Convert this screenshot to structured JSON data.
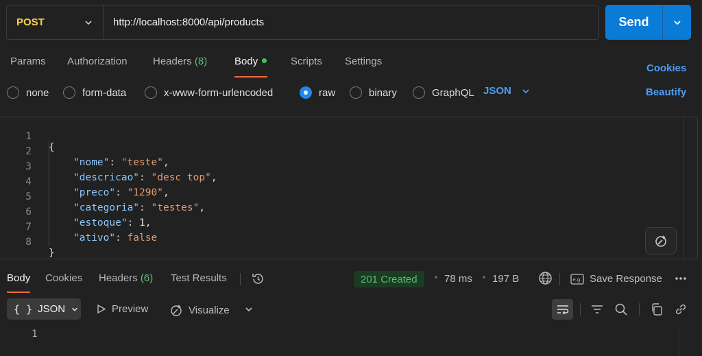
{
  "request": {
    "method": "POST",
    "url": "http://localhost:8000/api/products",
    "send_label": "Send"
  },
  "tabs": [
    {
      "label": "Params"
    },
    {
      "label": "Authorization"
    },
    {
      "label": "Headers",
      "count": "(8)"
    },
    {
      "label": "Body",
      "active": true
    },
    {
      "label": "Scripts"
    },
    {
      "label": "Settings"
    }
  ],
  "links": {
    "cookies": "Cookies",
    "beautify": "Beautify"
  },
  "body_types": [
    {
      "label": "none"
    },
    {
      "label": "form-data"
    },
    {
      "label": "x-www-form-urlencoded"
    },
    {
      "label": "raw",
      "selected": true
    },
    {
      "label": "binary"
    },
    {
      "label": "GraphQL"
    }
  ],
  "raw_format": "JSON",
  "editor": {
    "line_numbers": [
      "1",
      "2",
      "3",
      "4",
      "5",
      "6",
      "7",
      "8"
    ],
    "lines": [
      {
        "open": "{"
      },
      {
        "key": "\"nome\"",
        "value": "\"teste\"",
        "value_type": "str",
        "comma": ","
      },
      {
        "key": "\"descricao\"",
        "value": "\"desc top\"",
        "value_type": "str",
        "comma": ","
      },
      {
        "key": "\"preco\"",
        "value": "\"1290\"",
        "value_type": "str",
        "comma": ","
      },
      {
        "key": "\"categoria\"",
        "value": "\"testes\"",
        "value_type": "str",
        "comma": ","
      },
      {
        "key": "\"estoque\"",
        "value": "1",
        "value_type": "num",
        "comma": ","
      },
      {
        "key": "\"ativo\"",
        "value": "false",
        "value_type": "kw",
        "comma": ""
      },
      {
        "close": "}"
      }
    ]
  },
  "response": {
    "tabs": [
      {
        "label": "Body",
        "active": true
      },
      {
        "label": "Cookies"
      },
      {
        "label": "Headers",
        "count": "(6)"
      },
      {
        "label": "Test Results"
      }
    ],
    "status": "201 Created",
    "time": "78 ms",
    "size": "197 B",
    "save_label": "Save Response",
    "format": "JSON",
    "preview_label": "Preview",
    "visualize_label": "Visualize",
    "line_number": "1"
  },
  "colors": {
    "accent_send": "#0b7bd8",
    "method_post": "#ffd04a",
    "tab_active_underline": "#f26b3a",
    "status_ok": "#52c36a",
    "link": "#4d9ef5"
  }
}
